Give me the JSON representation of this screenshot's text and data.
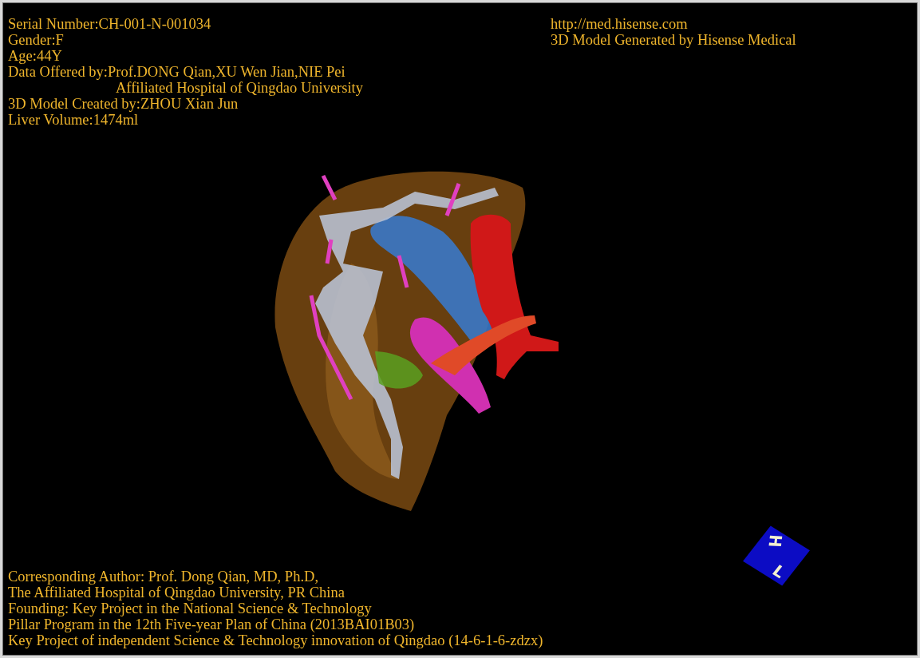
{
  "patient_info": [
    {
      "text": "Serial Number:CH-001-N-001034",
      "indented": false
    },
    {
      "text": "Gender:F",
      "indented": false
    },
    {
      "text": "Age:44Y",
      "indented": false
    },
    {
      "text": "Data Offered by:Prof.DONG Qian,XU Wen Jian,NIE Pei",
      "indented": false
    },
    {
      "text": "Affiliated Hospital of Qingdao University",
      "indented": true
    },
    {
      "text": "3D Model Created by:ZHOU Xian Jun",
      "indented": false
    },
    {
      "text": "Liver Volume:1474ml",
      "indented": false
    }
  ],
  "credits": [
    "http://med.hisense.com",
    "3D Model Generated by Hisense Medical"
  ],
  "funding": [
    "Corresponding Author: Prof. Dong Qian, MD, Ph.D,",
    "The Affiliated Hospital of Qingdao University, PR China",
    "Founding: Key Project in the National Science & Technology",
    "Pillar Program in the 12th Five-year Plan of China (2013BAI01B03)",
    "Key Project of independent Science & Technology innovation of Qingdao (14-6-1-6-zdzx)"
  ],
  "orientation_cube": {
    "labels": [
      "H",
      "L"
    ]
  }
}
